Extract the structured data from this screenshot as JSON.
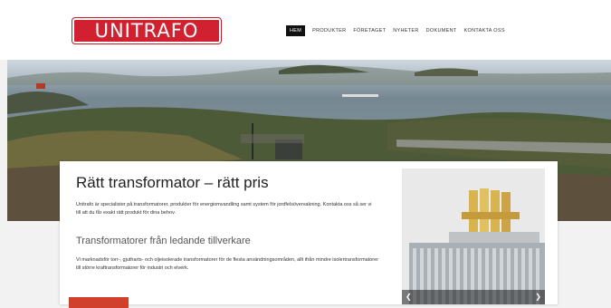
{
  "brand": {
    "logo_text": "UNITRAFO",
    "color": "#d1202f"
  },
  "nav": {
    "items": [
      "HEM",
      "PRODUKTER",
      "FÖRETAGET",
      "NYHETER",
      "DOKUMENT",
      "KONTAKTA OSS"
    ],
    "active": "HEM"
  },
  "main": {
    "title": "Rätt transformator – rätt pris",
    "intro": "Unitrafo är specialister på transformatorer, produkter för energiomvandling samt system för jordfelsövervakning. Kontakta oss så ser vi till att du får exakt rätt produkt för dina behov.",
    "subtitle": "Transformatorer från ledande tillverkare",
    "body": "Vi marknadsför torr-, gjutharts- och oljeisolerade transformatorer för de flesta användningsområden, allt ifrån mindre isolertransformatorer till större kraftransformatorer för industri och elverk."
  },
  "icons": {
    "prev": "chevron-left-icon",
    "next": "chevron-right-icon"
  }
}
